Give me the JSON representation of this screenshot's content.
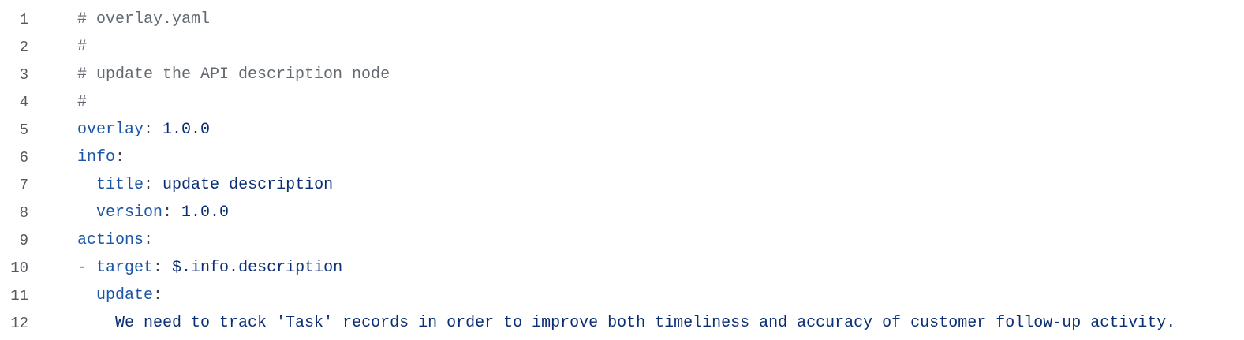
{
  "editor": {
    "lines": [
      {
        "num": "1",
        "indent": "",
        "comment": "# overlay.yaml"
      },
      {
        "num": "2",
        "indent": "",
        "comment": "#"
      },
      {
        "num": "3",
        "indent": "",
        "comment": "# update the API description node"
      },
      {
        "num": "4",
        "indent": "",
        "comment": "#"
      },
      {
        "num": "5",
        "indent": "",
        "key": "overlay",
        "colon": ":",
        "value": " 1.0.0"
      },
      {
        "num": "6",
        "indent": "",
        "key": "info",
        "colon": ":"
      },
      {
        "num": "7",
        "indent": "  ",
        "key": "title",
        "colon": ":",
        "value": " update description"
      },
      {
        "num": "8",
        "indent": "  ",
        "key": "version",
        "colon": ":",
        "value": " 1.0.0"
      },
      {
        "num": "9",
        "indent": "",
        "key": "actions",
        "colon": ":"
      },
      {
        "num": "10",
        "indent": "",
        "dash": "- ",
        "key": "target",
        "colon": ":",
        "value": " $.info.description"
      },
      {
        "num": "11",
        "indent": "  ",
        "key": "update",
        "colon": ":"
      },
      {
        "num": "12",
        "indent": "    ",
        "value": "We need to track 'Task' records in order to improve both timeliness and accuracy of customer follow-up activity."
      }
    ]
  },
  "colors": {
    "comment": "#626970",
    "key": "#1b56a6",
    "value": "#0b2f74",
    "line_number": "#555a60",
    "background": "#ffffff"
  }
}
